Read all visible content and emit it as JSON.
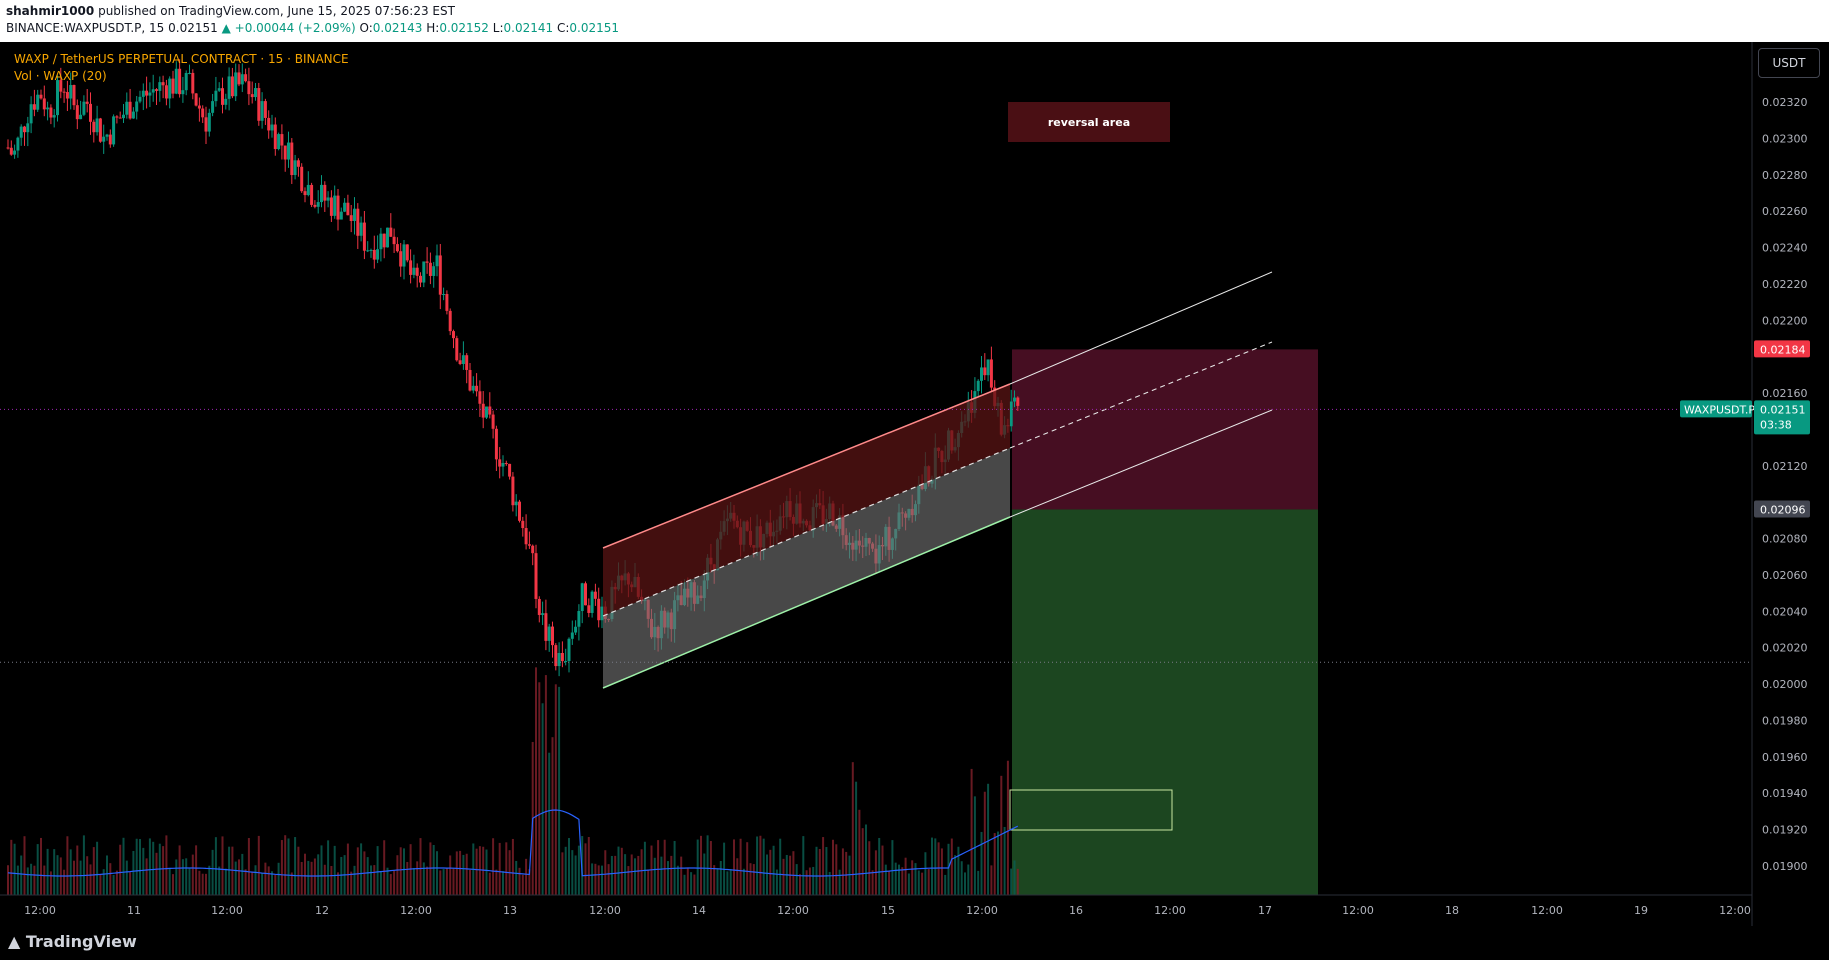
{
  "header": {
    "published_user": "shahmir1000",
    "published_text": " published on TradingView.com, June 15, 2025 07:56:23 EST",
    "symbol_line": "BINANCE:WAXPUSDT.P, 15",
    "last": "0.02151",
    "change": "▲ +0.00044 (+2.09%)",
    "o_label": "O:",
    "o": "0.02143",
    "h_label": "H:",
    "h": "0.02152",
    "l_label": "L:",
    "l": "0.02141",
    "c_label": "C:",
    "c": "0.02151"
  },
  "legend": {
    "title": "WAXP / TetherUS PERPETUAL CONTRACT · 15 · BINANCE",
    "volume": "Vol · WAXP (20)"
  },
  "currency_button": "USDT",
  "annotation": {
    "text": "reversal area"
  },
  "price_labels": {
    "symbol": "WAXPUSDT.P",
    "last": "0.02151",
    "countdown": "03:38",
    "stop": "0.02184",
    "entry": "0.02096"
  },
  "footer": {
    "brand": "TradingView"
  },
  "colors": {
    "up": "#089981",
    "down": "#f23645",
    "volume_ma": "#2962ff",
    "stop_zone": "#4a0f24",
    "target_zone": "#1e4a22"
  },
  "chart_data": {
    "type": "candlestick",
    "symbol": "WAXPUSDT.P",
    "interval": "15",
    "y_ticks": [
      "0.02320",
      "0.02300",
      "0.02280",
      "0.02260",
      "0.02240",
      "0.02220",
      "0.02200",
      "0.02160",
      "0.02120",
      "0.02080",
      "0.02060",
      "0.02040",
      "0.02020",
      "0.02000",
      "0.01980",
      "0.01960",
      "0.01940",
      "0.01920",
      "0.01900"
    ],
    "x_ticks": [
      "12:00",
      "11",
      "12:00",
      "12",
      "12:00",
      "13",
      "12:00",
      "14",
      "12:00",
      "15",
      "12:00",
      "16",
      "12:00",
      "17",
      "12:00",
      "18",
      "12:00",
      "19",
      "12:00"
    ],
    "ylim": [
      0.0189,
      0.0234
    ],
    "close_path": [
      [
        0.0228,
        0.02295
      ],
      [
        0.0229,
        0.0229
      ],
      [
        0.023,
        0.023
      ],
      [
        0.0232,
        0.0232
      ],
      [
        0.0234,
        0.02325
      ],
      [
        0.0235,
        0.02315
      ],
      [
        0.0236,
        0.0232
      ],
      [
        0.0238,
        0.0233
      ],
      [
        0.024,
        0.02315
      ],
      [
        0.0242,
        0.0232
      ],
      [
        0.0245,
        0.023
      ],
      [
        0.025,
        0.0232
      ],
      [
        0.0253,
        0.02325
      ],
      [
        0.0256,
        0.0233
      ],
      [
        0.026,
        0.0233
      ],
      [
        0.0263,
        0.0231
      ],
      [
        0.0266,
        0.02325
      ],
      [
        0.027,
        0.0233
      ],
      [
        0.0272,
        0.0232
      ],
      [
        0.0278,
        0.0229
      ],
      [
        0.0282,
        0.0227
      ],
      [
        0.0288,
        0.0226
      ],
      [
        0.0292,
        0.0224
      ],
      [
        0.0296,
        0.0225
      ],
      [
        0.03,
        0.0222
      ],
      [
        0.0304,
        0.0223
      ],
      [
        0.0308,
        0.0218
      ],
      [
        0.0312,
        0.0215
      ],
      [
        0.0316,
        0.0212
      ],
      [
        0.032,
        0.0208
      ],
      [
        0.0323,
        0.0203
      ],
      [
        0.0326,
        0.0201
      ],
      [
        0.033,
        0.0205
      ],
      [
        0.0334,
        0.0204
      ],
      [
        0.0338,
        0.0206
      ],
      [
        0.0342,
        0.0203
      ],
      [
        0.0346,
        0.0204
      ],
      [
        0.035,
        0.0205
      ],
      [
        0.0353,
        0.0207
      ],
      [
        0.0356,
        0.0209
      ],
      [
        0.036,
        0.0208
      ],
      [
        0.0363,
        0.02085
      ],
      [
        0.0366,
        0.021
      ],
      [
        0.037,
        0.0209
      ],
      [
        0.0374,
        0.02095
      ],
      [
        0.0378,
        0.0208
      ],
      [
        0.0382,
        0.0207
      ],
      [
        0.0386,
        0.0209
      ],
      [
        0.039,
        0.0211
      ],
      [
        0.0394,
        0.0213
      ],
      [
        0.0398,
        0.0215
      ],
      [
        0.0401,
        0.0218
      ],
      [
        0.0404,
        0.0214
      ],
      [
        0.0407,
        0.02151
      ]
    ],
    "volume_spikes_at": [
      "13",
      "14",
      "15 12:00"
    ],
    "channel": {
      "upper": [
        [
          0.0345,
          0.02078
        ],
        [
          0.0405,
          0.02172
        ]
      ],
      "mid": [
        [
          0.0345,
          0.02044
        ],
        [
          0.0425,
          0.02193
        ]
      ],
      "lower": [
        [
          0.0345,
          0.02007
        ],
        [
          0.0405,
          0.02096
        ]
      ],
      "projection_upper": [
        [
          0.0405,
          0.02172
        ],
        [
          0.042,
          0.0223
        ]
      ],
      "projection_lower": [
        [
          0.0405,
          0.02096
        ],
        [
          0.042,
          0.02155
        ]
      ]
    },
    "position": {
      "type": "short",
      "entry": 0.02096,
      "stop": 0.02184,
      "target": 0.0189
    },
    "last_price": 0.02151,
    "horizontal_dotted_levels": [
      0.02151,
      0.02012
    ]
  }
}
